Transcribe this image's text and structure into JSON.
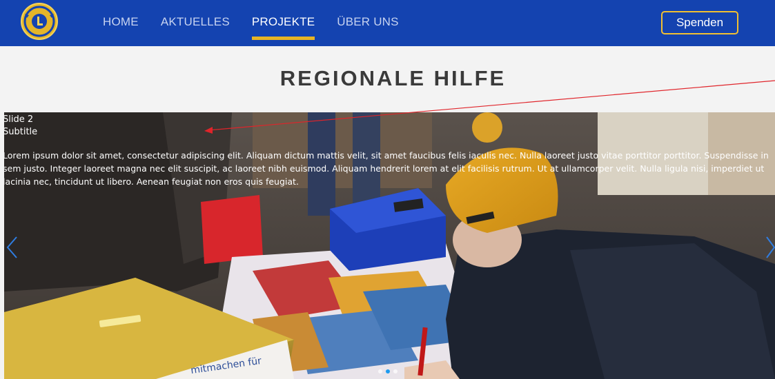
{
  "header": {
    "nav": [
      {
        "label": "HOME",
        "active": false
      },
      {
        "label": "AKTUELLES",
        "active": false
      },
      {
        "label": "PROJEKTE",
        "active": true
      },
      {
        "label": "ÜBER UNS",
        "active": false
      }
    ],
    "donate_label": "Spenden",
    "brand_color": "#1443b0",
    "accent_color": "#e8b423"
  },
  "section": {
    "title": "REGIONALE HILFE"
  },
  "slider": {
    "slide_title": "Slide 2",
    "slide_subtitle": "Subtitle",
    "slide_text": "Lorem ipsum dolor sit amet, consectetur adipiscing elit. Aliquam dictum mattis velit, sit amet faucibus felis iaculis nec. Nulla laoreet justo vitae porttitor porttitor. Suspendisse in sem justo. Integer laoreet magna nec elit suscipit, ac laoreet nibh euismod. Aliquam hendrerit lorem at elit facilisis rutrum. Ut at ullamcorper velit. Nulla ligula nisi, imperdiet ut lacinia nec, tincidunt ut libero. Aenean feugiat non eros quis feugiat.",
    "box_text": "mitmachen für",
    "active_slide": 2,
    "slide_count": 3,
    "prev_icon": "chevron-left-icon",
    "next_icon": "chevron-right-icon"
  }
}
